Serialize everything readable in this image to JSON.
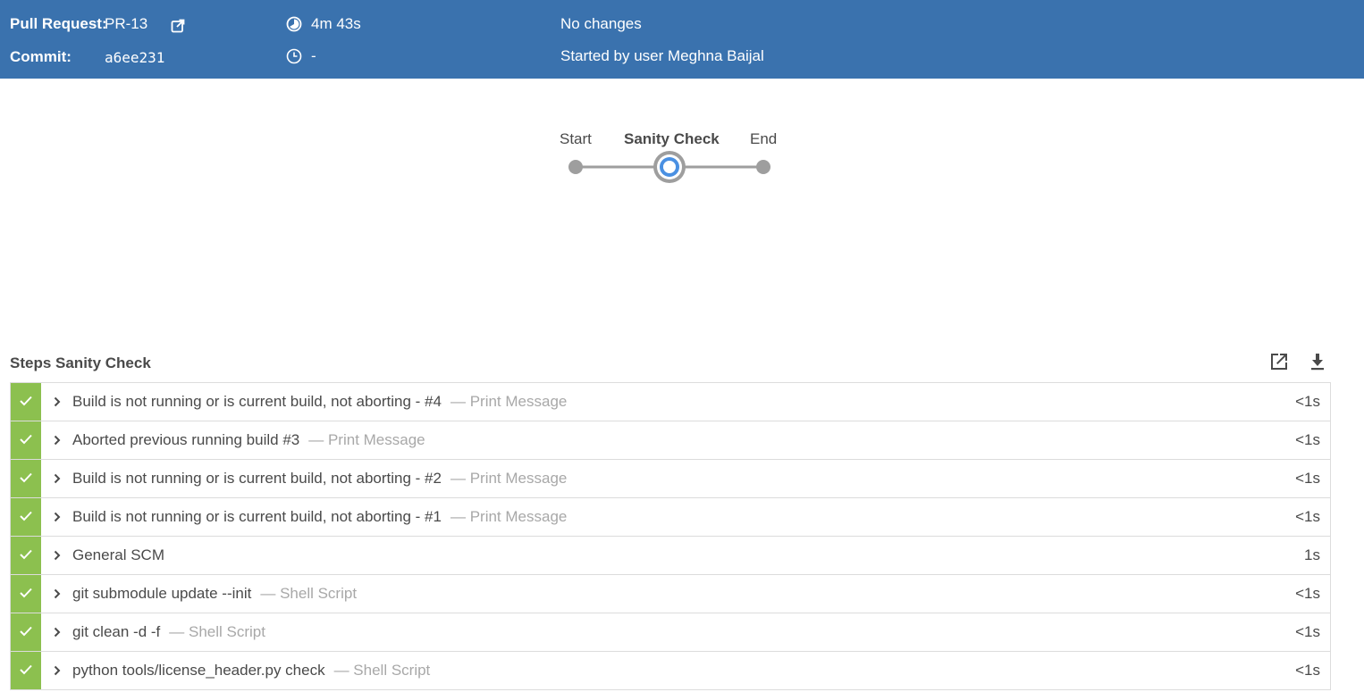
{
  "header": {
    "pr_label": "Pull Request:",
    "pr_value": "PR-13",
    "commit_label": "Commit:",
    "commit_value": "a6ee231",
    "duration": "4m 43s",
    "started_ago": "-",
    "changes": "No changes",
    "started_by": "Started by user Meghna Baijal",
    "icons": [
      "external-link-icon",
      "duration-icon",
      "clock-icon"
    ]
  },
  "pipeline": {
    "stages": [
      {
        "name": "Start",
        "state": "start"
      },
      {
        "name": "Sanity Check",
        "state": "running",
        "selected": true
      },
      {
        "name": "End",
        "state": "end"
      }
    ]
  },
  "steps": {
    "title": "Steps Sanity Check",
    "tools": [
      "open-in-new-icon",
      "download-icon"
    ],
    "items": [
      {
        "label": "Build is not running or is current build, not aborting - #4",
        "kind": "— Print Message",
        "duration": "<1s",
        "status": "success"
      },
      {
        "label": "Aborted previous running build #3",
        "kind": "— Print Message",
        "duration": "<1s",
        "status": "success"
      },
      {
        "label": "Build is not running or is current build, not aborting - #2",
        "kind": "— Print Message",
        "duration": "<1s",
        "status": "success"
      },
      {
        "label": "Build is not running or is current build, not aborting - #1",
        "kind": "— Print Message",
        "duration": "<1s",
        "status": "success"
      },
      {
        "label": "General SCM",
        "kind": "",
        "duration": "1s",
        "status": "success"
      },
      {
        "label": "git submodule update --init",
        "kind": "— Shell Script",
        "duration": "<1s",
        "status": "success"
      },
      {
        "label": "git clean -d -f",
        "kind": "— Shell Script",
        "duration": "<1s",
        "status": "success"
      },
      {
        "label": "python tools/license_header.py check",
        "kind": "— Shell Script",
        "duration": "<1s",
        "status": "success"
      }
    ]
  },
  "colors": {
    "header_bg": "#3a72ae",
    "success": "#8cc04f",
    "running": "#4a90e2",
    "muted_text": "#a8a8a8"
  }
}
